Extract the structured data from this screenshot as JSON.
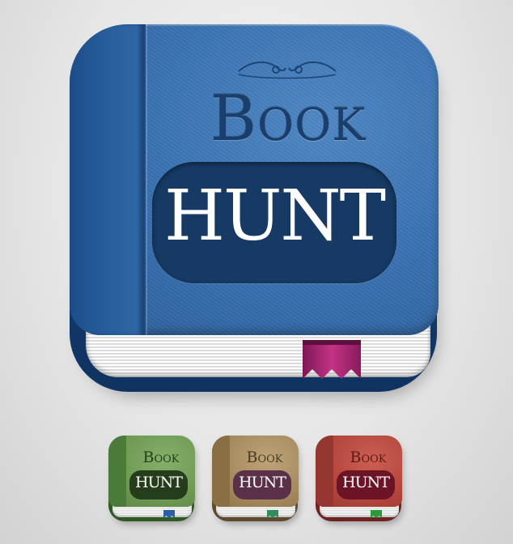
{
  "main_icon": {
    "title_top": "Book",
    "title_bottom": "HUNT",
    "colors": {
      "cover": "#3a73b3",
      "spine": "#2a5f9d",
      "plate": "#163a64",
      "title_top": "#1b3f6d",
      "bookmark": "#a0226e"
    }
  },
  "variants": [
    {
      "name": "green",
      "title_top": "Book",
      "title_bottom": "HUNT",
      "cover": "#6f9a54",
      "spine": "#4c7a39",
      "back": "#2f5a23",
      "plate": "#263d1c",
      "title_top_color": "#243f1a",
      "bookmark": "#2b5ea8"
    },
    {
      "name": "brown",
      "title_top": "Book",
      "title_bottom": "HUNT",
      "cover": "#a48a5e",
      "spine": "#8a6e44",
      "back": "#5e4a2e",
      "plate": "#5a3148",
      "title_top_color": "#4a3a22",
      "bookmark": "#2f8f5a"
    },
    {
      "name": "red",
      "title_top": "Book",
      "title_bottom": "HUNT",
      "cover": "#b4473e",
      "spine": "#963630",
      "back": "#6e2320",
      "plate": "#6d1326",
      "title_top_color": "#5e1a16",
      "bookmark": "#2b9a3c"
    }
  ]
}
